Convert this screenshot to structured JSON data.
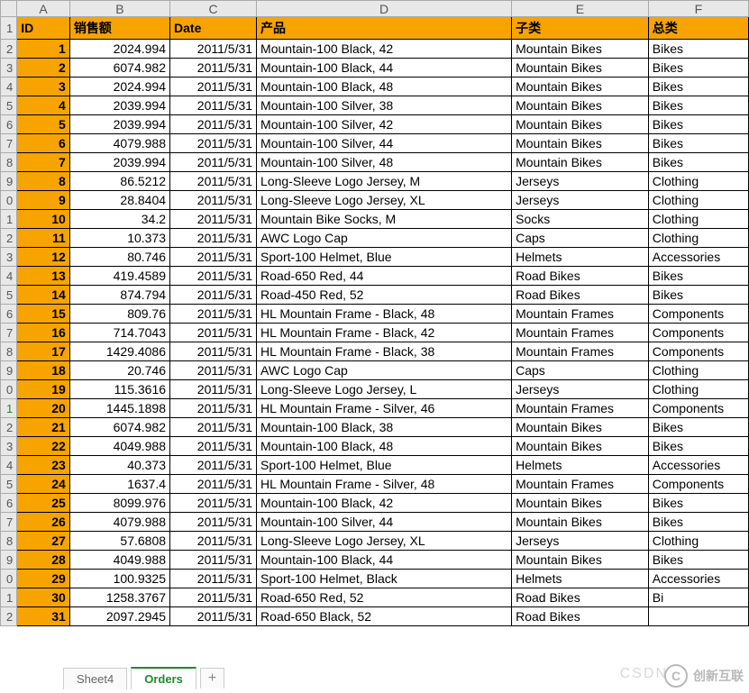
{
  "columns": [
    "A",
    "B",
    "C",
    "D",
    "E",
    "F"
  ],
  "headers": {
    "A": "ID",
    "B": "销售额",
    "C": "Date",
    "D": "产品",
    "E": "子类",
    "F": "总类"
  },
  "rowNumbers": [
    "1",
    "2",
    "3",
    "4",
    "5",
    "6",
    "7",
    "8",
    "9",
    "0",
    "1",
    "2",
    "3",
    "4",
    "5",
    "6",
    "7",
    "8",
    "9",
    "0",
    "1",
    "2",
    "3",
    "4",
    "5",
    "6",
    "7",
    "8",
    "9",
    "0",
    "1",
    "2"
  ],
  "greenRowIndex": 20,
  "rows": [
    {
      "id": "1",
      "b": "2024.994",
      "c": "2011/5/31",
      "d": "Mountain-100 Black, 42",
      "e": "Mountain Bikes",
      "f": "Bikes"
    },
    {
      "id": "2",
      "b": "6074.982",
      "c": "2011/5/31",
      "d": "Mountain-100 Black, 44",
      "e": "Mountain Bikes",
      "f": "Bikes"
    },
    {
      "id": "3",
      "b": "2024.994",
      "c": "2011/5/31",
      "d": "Mountain-100 Black, 48",
      "e": "Mountain Bikes",
      "f": "Bikes"
    },
    {
      "id": "4",
      "b": "2039.994",
      "c": "2011/5/31",
      "d": "Mountain-100 Silver, 38",
      "e": "Mountain Bikes",
      "f": "Bikes"
    },
    {
      "id": "5",
      "b": "2039.994",
      "c": "2011/5/31",
      "d": "Mountain-100 Silver, 42",
      "e": "Mountain Bikes",
      "f": "Bikes"
    },
    {
      "id": "6",
      "b": "4079.988",
      "c": "2011/5/31",
      "d": "Mountain-100 Silver, 44",
      "e": "Mountain Bikes",
      "f": "Bikes"
    },
    {
      "id": "7",
      "b": "2039.994",
      "c": "2011/5/31",
      "d": "Mountain-100 Silver, 48",
      "e": "Mountain Bikes",
      "f": "Bikes"
    },
    {
      "id": "8",
      "b": "86.5212",
      "c": "2011/5/31",
      "d": "Long-Sleeve Logo Jersey, M",
      "e": "Jerseys",
      "f": "Clothing"
    },
    {
      "id": "9",
      "b": "28.8404",
      "c": "2011/5/31",
      "d": "Long-Sleeve Logo Jersey, XL",
      "e": "Jerseys",
      "f": "Clothing"
    },
    {
      "id": "10",
      "b": "34.2",
      "c": "2011/5/31",
      "d": "Mountain Bike Socks, M",
      "e": "Socks",
      "f": "Clothing"
    },
    {
      "id": "11",
      "b": "10.373",
      "c": "2011/5/31",
      "d": "AWC Logo Cap",
      "e": "Caps",
      "f": "Clothing"
    },
    {
      "id": "12",
      "b": "80.746",
      "c": "2011/5/31",
      "d": "Sport-100 Helmet, Blue",
      "e": "Helmets",
      "f": "Accessories"
    },
    {
      "id": "13",
      "b": "419.4589",
      "c": "2011/5/31",
      "d": "Road-650 Red, 44",
      "e": "Road Bikes",
      "f": "Bikes"
    },
    {
      "id": "14",
      "b": "874.794",
      "c": "2011/5/31",
      "d": "Road-450 Red, 52",
      "e": "Road Bikes",
      "f": "Bikes"
    },
    {
      "id": "15",
      "b": "809.76",
      "c": "2011/5/31",
      "d": "HL Mountain Frame - Black, 48",
      "e": "Mountain Frames",
      "f": "Components"
    },
    {
      "id": "16",
      "b": "714.7043",
      "c": "2011/5/31",
      "d": "HL Mountain Frame - Black, 42",
      "e": "Mountain Frames",
      "f": "Components"
    },
    {
      "id": "17",
      "b": "1429.4086",
      "c": "2011/5/31",
      "d": "HL Mountain Frame - Black, 38",
      "e": "Mountain Frames",
      "f": "Components"
    },
    {
      "id": "18",
      "b": "20.746",
      "c": "2011/5/31",
      "d": "AWC Logo Cap",
      "e": "Caps",
      "f": "Clothing"
    },
    {
      "id": "19",
      "b": "115.3616",
      "c": "2011/5/31",
      "d": "Long-Sleeve Logo Jersey, L",
      "e": "Jerseys",
      "f": "Clothing"
    },
    {
      "id": "20",
      "b": "1445.1898",
      "c": "2011/5/31",
      "d": "HL Mountain Frame - Silver, 46",
      "e": "Mountain Frames",
      "f": "Components"
    },
    {
      "id": "21",
      "b": "6074.982",
      "c": "2011/5/31",
      "d": "Mountain-100 Black, 38",
      "e": "Mountain Bikes",
      "f": "Bikes"
    },
    {
      "id": "22",
      "b": "4049.988",
      "c": "2011/5/31",
      "d": "Mountain-100 Black, 48",
      "e": "Mountain Bikes",
      "f": "Bikes"
    },
    {
      "id": "23",
      "b": "40.373",
      "c": "2011/5/31",
      "d": "Sport-100 Helmet, Blue",
      "e": "Helmets",
      "f": "Accessories"
    },
    {
      "id": "24",
      "b": "1637.4",
      "c": "2011/5/31",
      "d": "HL Mountain Frame - Silver, 48",
      "e": "Mountain Frames",
      "f": "Components"
    },
    {
      "id": "25",
      "b": "8099.976",
      "c": "2011/5/31",
      "d": "Mountain-100 Black, 42",
      "e": "Mountain Bikes",
      "f": "Bikes"
    },
    {
      "id": "26",
      "b": "4079.988",
      "c": "2011/5/31",
      "d": "Mountain-100 Silver, 44",
      "e": "Mountain Bikes",
      "f": "Bikes"
    },
    {
      "id": "27",
      "b": "57.6808",
      "c": "2011/5/31",
      "d": "Long-Sleeve Logo Jersey, XL",
      "e": "Jerseys",
      "f": "Clothing"
    },
    {
      "id": "28",
      "b": "4049.988",
      "c": "2011/5/31",
      "d": "Mountain-100 Black, 44",
      "e": "Mountain Bikes",
      "f": "Bikes"
    },
    {
      "id": "29",
      "b": "100.9325",
      "c": "2011/5/31",
      "d": "Sport-100 Helmet, Black",
      "e": "Helmets",
      "f": "Accessories"
    },
    {
      "id": "30",
      "b": "1258.3767",
      "c": "2011/5/31",
      "d": "Road-650 Red, 52",
      "e": "Road Bikes",
      "f": "Bi"
    },
    {
      "id": "31",
      "b": "2097.2945",
      "c": "2011/5/31",
      "d": "Road-650 Black, 52",
      "e": "Road Bikes",
      "f": ""
    }
  ],
  "tabs": {
    "sheet4": "Sheet4",
    "orders": "Orders",
    "add": "+"
  },
  "watermark": {
    "csdn": "CSDN",
    "cxhl": "创新互联",
    "logoLetter": "C"
  }
}
